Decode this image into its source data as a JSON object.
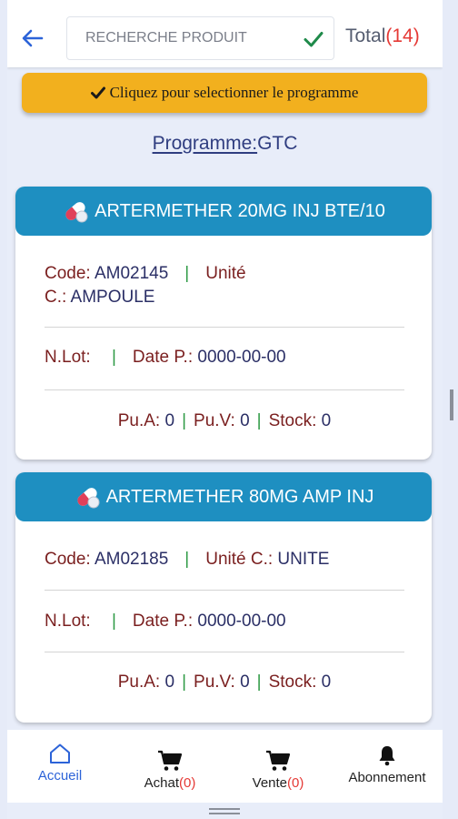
{
  "header": {
    "search_placeholder": "RECHERCHE PRODUIT",
    "total_label": "Total",
    "total_count": "(14)"
  },
  "program_button": {
    "label": "Cliquez pour selectionner le programme"
  },
  "program": {
    "key": "Programme:",
    "value": "GTC"
  },
  "products": [
    {
      "name": "ARTERMETHER 20MG INJ BTE/10",
      "code_label": "Code:",
      "code": "AM02145",
      "unit_label_line1": "Unité",
      "unit_label_line2": "C.:",
      "unit": "AMPOULE",
      "lot_label": "N.Lot:",
      "lot": "",
      "date_label": "Date P.:",
      "date": "0000-00-00",
      "pua_label": "Pu.A:",
      "pua": "0",
      "puv_label": "Pu.V:",
      "puv": "0",
      "stock_label": "Stock:",
      "stock": "0"
    },
    {
      "name": "ARTERMETHER 80MG AMP INJ",
      "code_label": "Code:",
      "code": "AM02185",
      "unit_label": "Unité C.:",
      "unit": "UNITE",
      "lot_label": "N.Lot:",
      "lot": "",
      "date_label": "Date P.:",
      "date": "0000-00-00",
      "pua_label": "Pu.A:",
      "pua": "0",
      "puv_label": "Pu.V:",
      "puv": "0",
      "stock_label": "Stock:",
      "stock": "0"
    }
  ],
  "nav": {
    "home": "Accueil",
    "purchase": "Achat",
    "purchase_count": "(0)",
    "sale": "Vente",
    "sale_count": "(0)",
    "subscription": "Abonnement"
  },
  "colors": {
    "accent_blue": "#1e8fc1",
    "button_yellow": "#f2b01e",
    "count_red": "#e53935",
    "active_nav": "#2c63d8",
    "check_green": "#2e9a45"
  }
}
